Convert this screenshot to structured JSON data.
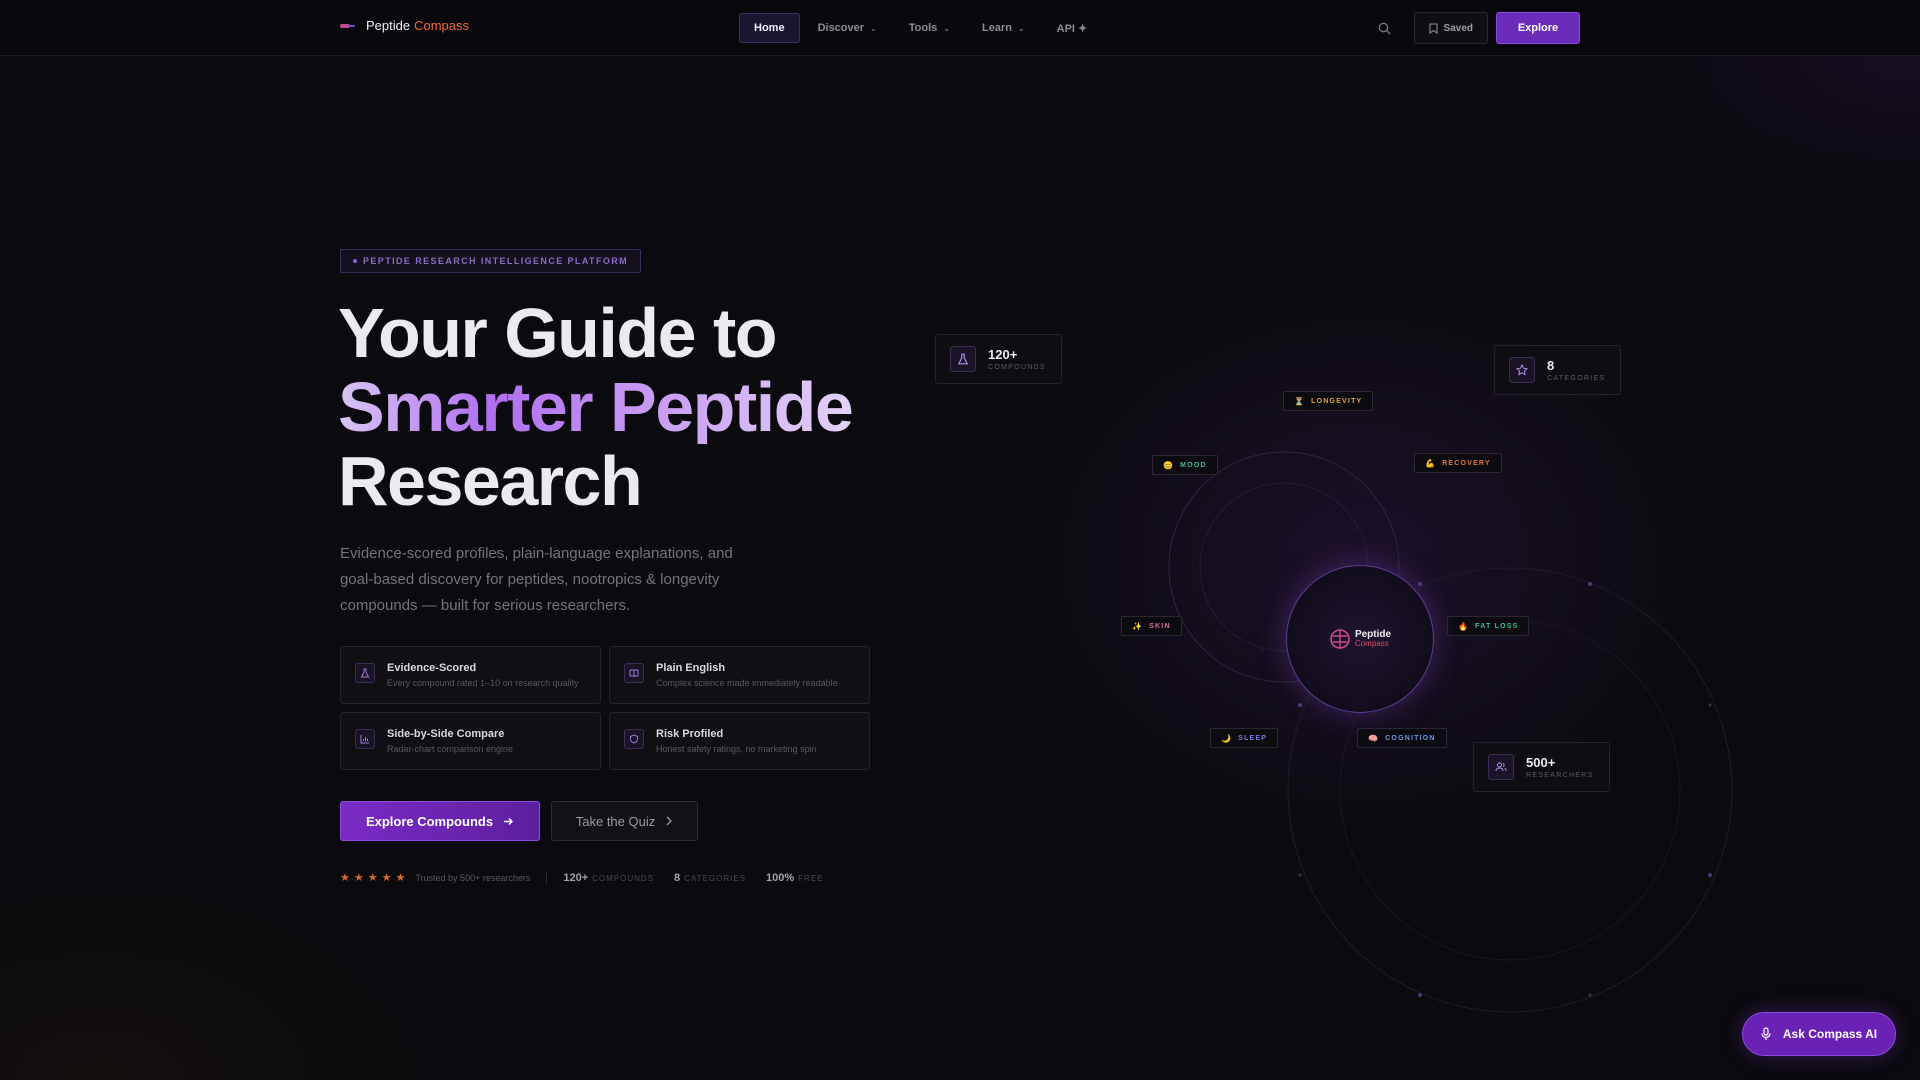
{
  "nav": {
    "brand_part1": "Peptide",
    "brand_part2": "Compass",
    "links": [
      {
        "label": "Home"
      },
      {
        "label": "Discover"
      },
      {
        "label": "Tools"
      },
      {
        "label": "Learn"
      },
      {
        "label": "API ✦"
      }
    ],
    "saved_label": "Saved",
    "explore_label": "Explore"
  },
  "hero": {
    "badge": "PEPTIDE RESEARCH INTELLIGENCE PLATFORM",
    "title_line1": "Your Guide to",
    "title_line2": "Smarter Peptide",
    "title_line3": "Research",
    "subtitle": "Evidence-scored profiles, plain-language explanations, and goal-based discovery for peptides, nootropics & longevity compounds — built for serious researchers.",
    "features": [
      {
        "title": "Evidence-Scored",
        "desc": "Every compound rated 1–10 on research quality",
        "icon": "flask-icon"
      },
      {
        "title": "Plain English",
        "desc": "Complex science made immediately readable",
        "icon": "book-icon"
      },
      {
        "title": "Side-by-Side Compare",
        "desc": "Radar-chart comparison engine",
        "icon": "chart-icon"
      },
      {
        "title": "Risk Profiled",
        "desc": "Honest safety ratings, no marketing spin",
        "icon": "shield-icon"
      }
    ],
    "cta_primary": "Explore Compounds",
    "cta_secondary": "Take the Quiz",
    "rating": 5,
    "trust_text": "Trusted by 500+ researchers",
    "inline_stats": [
      {
        "value": "120+",
        "label": "COMPOUNDS"
      },
      {
        "value": "8",
        "label": "CATEGORIES"
      },
      {
        "value": "100%",
        "label": "FREE"
      }
    ]
  },
  "visual": {
    "stat_cards": [
      {
        "value": "120+",
        "label": "COMPOUNDS",
        "icon": "flask-icon"
      },
      {
        "value": "8",
        "label": "CATEGORIES",
        "icon": "star-icon"
      },
      {
        "value": "500+",
        "label": "RESEARCHERS",
        "icon": "users-icon"
      }
    ],
    "chips": [
      {
        "label": "LONGEVITY",
        "emoji": "⏳",
        "color": "#e0a43a"
      },
      {
        "label": "MOOD",
        "emoji": "😊",
        "color": "#3fbf8f"
      },
      {
        "label": "RECOVERY",
        "emoji": "💪",
        "color": "#e07a3a"
      },
      {
        "label": "SKIN",
        "emoji": "✨",
        "color": "#e06a9a"
      },
      {
        "label": "FAT LOSS",
        "emoji": "🔥",
        "color": "#3fbf8f"
      },
      {
        "label": "SLEEP",
        "emoji": "🌙",
        "color": "#7a7ae0"
      },
      {
        "label": "COGNITION",
        "emoji": "🧠",
        "color": "#6a9ae0"
      }
    ],
    "center_logo_line1": "Peptide",
    "center_logo_line2": "Compass"
  },
  "ask_ai_label": "Ask Compass AI",
  "colors": {
    "accent": "#6a2bb8",
    "brand_orange": "#f26b3a",
    "star": "#d9692f"
  }
}
